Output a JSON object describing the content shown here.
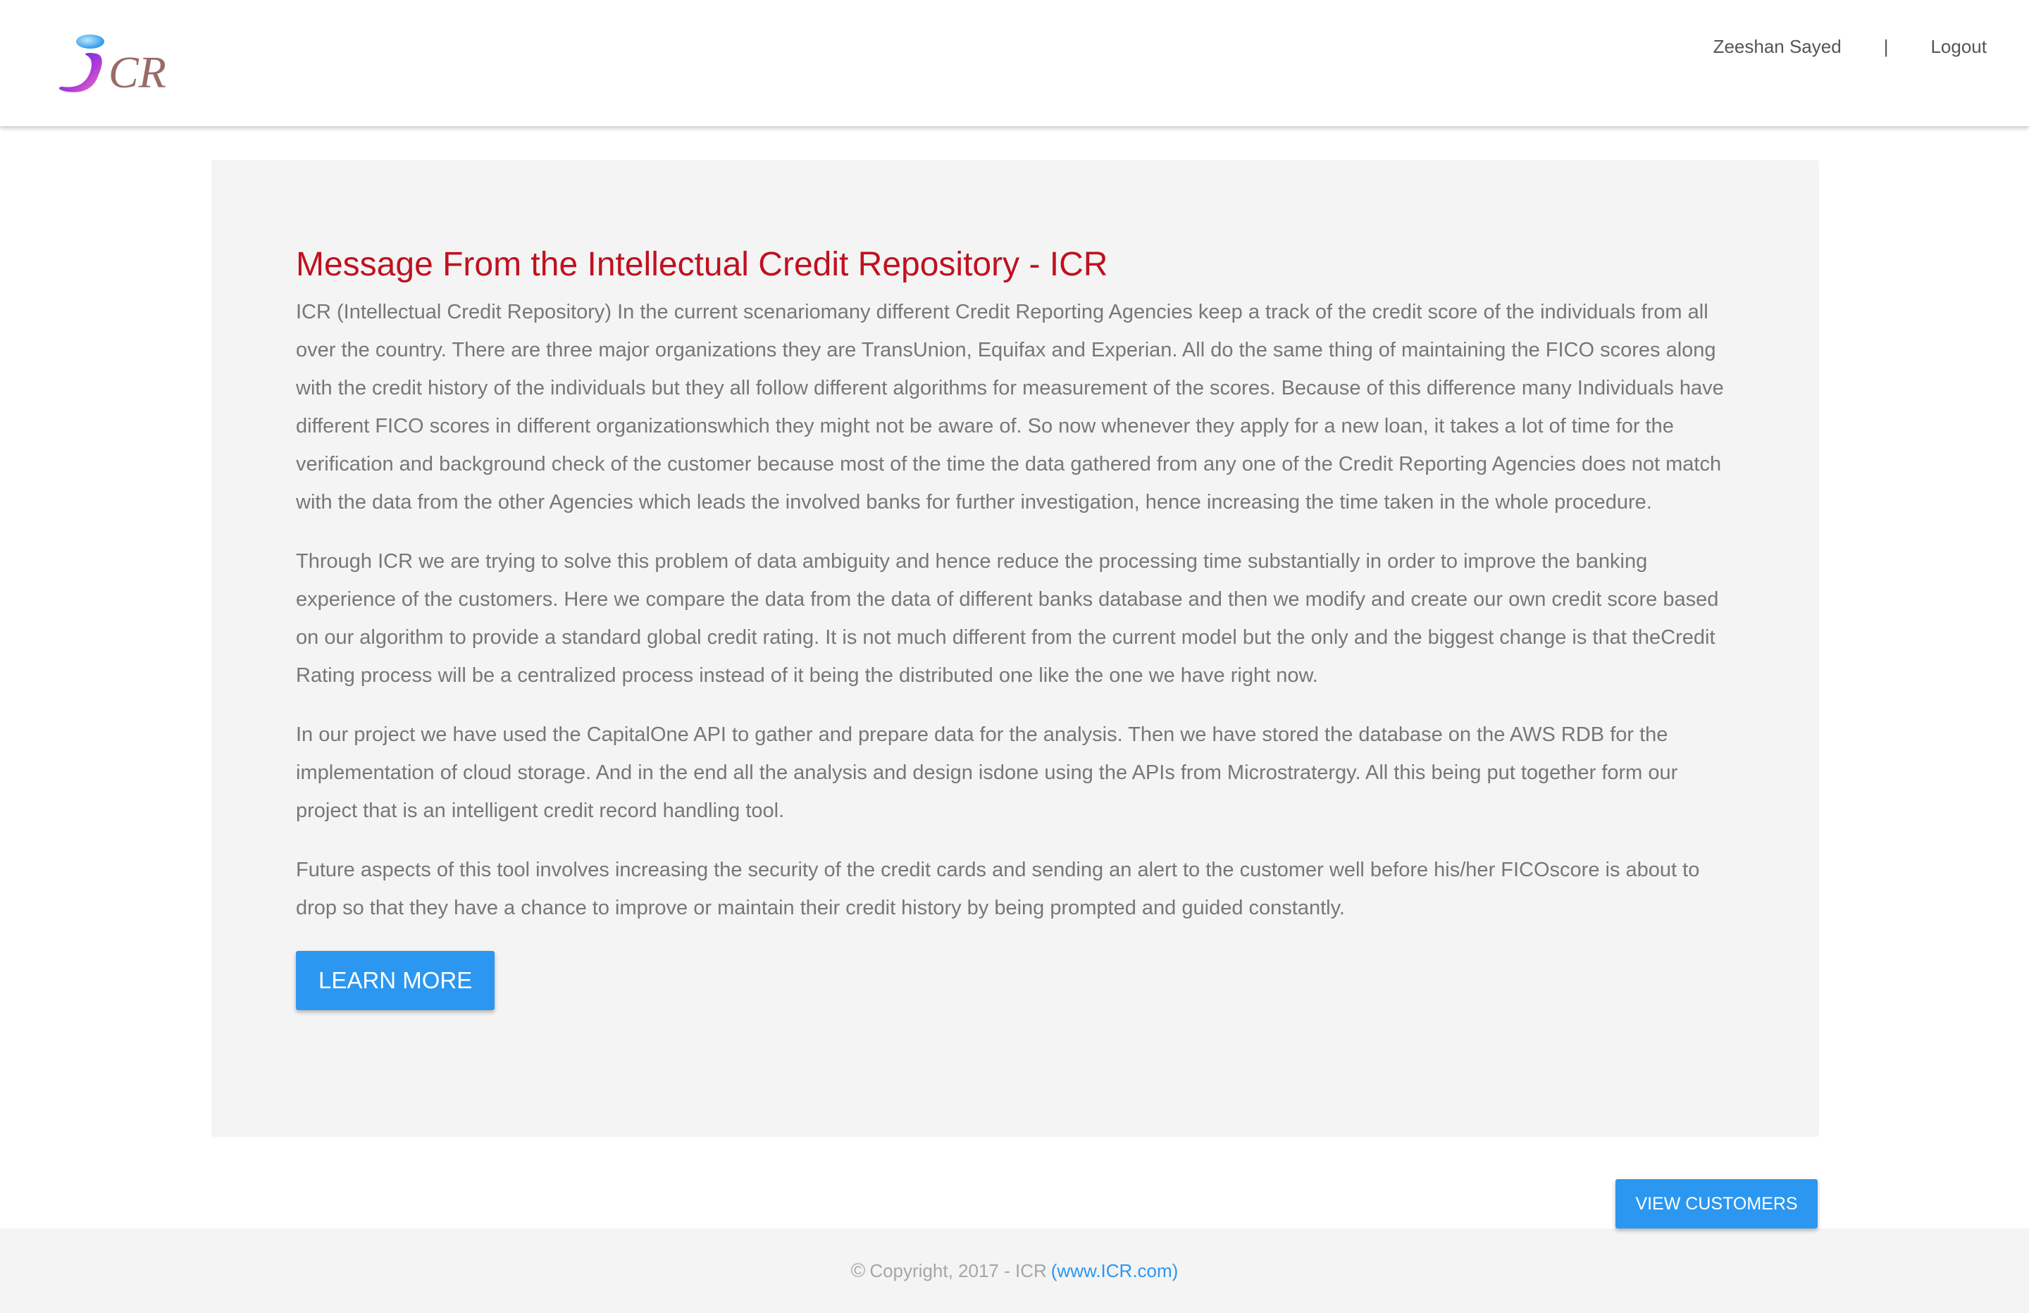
{
  "header": {
    "logo_text": "iCR",
    "user_name": "Zeeshan Sayed",
    "separator": "|",
    "logout_label": "Logout"
  },
  "card": {
    "title": "Message From the Intellectual Credit Repository - ICR",
    "paragraphs": [
      "ICR (Intellectual Credit Repository) In the current scenariomany different Credit Reporting Agencies keep a track of the credit score of the individuals from all over the country. There are three major organizations they are TransUnion, Equifax and Experian. All do the same thing of maintaining the FICO scores along with the credit history of the individuals but they all follow different algorithms for measurement of the scores. Because of this difference many Individuals have different FICO scores in different organizationswhich they might not be aware of. So now whenever they apply for a new loan, it takes a lot of time for the verification and background check of the customer because most of the time the data gathered from any one of the Credit Reporting Agencies does not match with the data from the other Agencies which leads the involved banks for further investigation, hence increasing the time taken in the whole procedure.",
      "Through ICR we are trying to solve this problem of data ambiguity and hence reduce the processing time substantially in order to improve the banking experience of the customers. Here we compare the data from the data of different banks database and then we modify and create our own credit score based on our algorithm to provide a standard global credit rating. It is not much different from the current model but the only and the biggest change is that theCredit Rating process will be a centralized process instead of it being the distributed one like the one we have right now.",
      "In our project we have used the CapitalOne API to gather and prepare data for the analysis. Then we have stored the database on the AWS RDB for the implementation of cloud storage. And in the end all the analysis and design isdone using the APIs from Microstratergy. All this being put together form our project that is an intelligent credit record handling tool.",
      "Future aspects of this tool involves increasing the security of the credit cards and sending an alert to the customer well before his/her FICOscore is about to drop so that they have a chance to improve or maintain their credit history by being prompted and guided constantly."
    ],
    "learn_more_label": "LEARN MORE"
  },
  "actions": {
    "view_customers_label": "VIEW CUSTOMERS"
  },
  "footer": {
    "copyright_symbol": "©",
    "copyright_text": "Copyright, 2017 - ICR",
    "link_text": "(www.ICR.com)"
  },
  "colors": {
    "accent": "#2b97f0",
    "title_red": "#c0111f",
    "card_bg": "#f4f4f4"
  }
}
